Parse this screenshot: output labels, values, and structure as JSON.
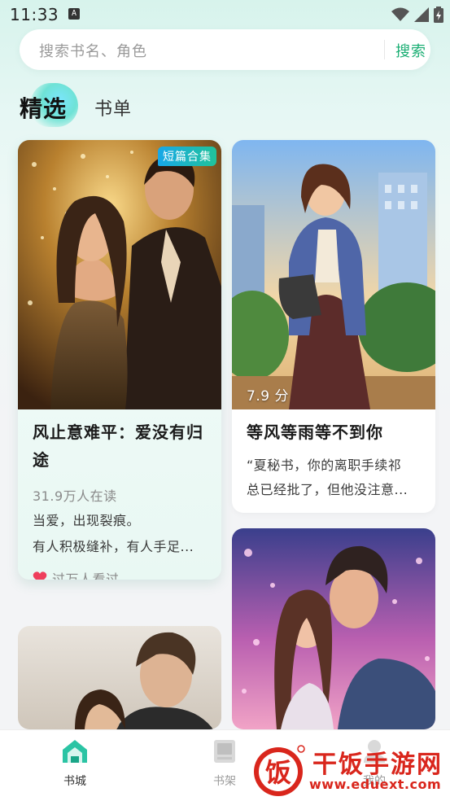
{
  "status_bar": {
    "time": "11:33",
    "notification_letter": "A"
  },
  "search": {
    "placeholder": "搜索书名、角色",
    "button_label": "搜索"
  },
  "tabs": [
    {
      "label": "精选",
      "selected": true
    },
    {
      "label": "书单",
      "selected": false
    }
  ],
  "books": [
    {
      "badge": "短篇合集",
      "title_line1": "风止意难平：爱没有归",
      "title_line2": "途",
      "readers": "31.9万人在读",
      "desc_line1": "当爱，出现裂痕。",
      "desc_line2": "有人积极缝补，有人手足...",
      "seen_label": "过万人看过"
    },
    {
      "score": "7.9 分",
      "title": "等风等雨等不到你",
      "desc_line1": "“夏秘书，你的离职手续祁",
      "desc_line2": "总已经批了，但他没注意..."
    },
    {
      "title": ""
    },
    {
      "title": ""
    }
  ],
  "bottom_nav": [
    {
      "label": "书城",
      "icon": "home-icon",
      "active": true
    },
    {
      "label": "书架",
      "icon": "bookshelf-icon",
      "active": false
    },
    {
      "label": "我的",
      "icon": "profile-icon",
      "active": false
    }
  ],
  "watermark": {
    "logo_char": "饭",
    "text": "干饭手游网",
    "url": "www.eduext.com"
  },
  "colors": {
    "accent_green": "#1aae73",
    "badge_gradient_start": "#18a7e8",
    "badge_gradient_end": "#20c39a",
    "watermark_red": "#d9261c"
  }
}
